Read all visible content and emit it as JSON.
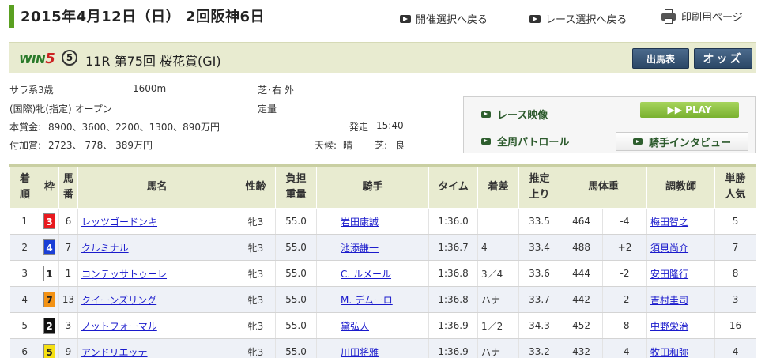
{
  "header": {
    "title": "2015年4月12日（日） 2回阪神6日",
    "links": [
      {
        "label": "開催選択へ戻る"
      },
      {
        "label": "レース選択へ戻る"
      },
      {
        "label": "印刷用ページ"
      }
    ]
  },
  "race": {
    "logo_win": "WIN",
    "logo_five": "5",
    "win5_leg": "5",
    "name": "11R 第75回 桜花賞(GI)",
    "buttons": {
      "entries": "出馬表",
      "odds": "オッズ"
    }
  },
  "info": {
    "class": "サラ系3歳",
    "distance": "1600m",
    "course": "芝･右 外",
    "conditions": "(国際)牝(指定) オープン",
    "weight_rule": "定量",
    "prize_label": "本賞金:",
    "prize": "8900、3600、2200、1300、890万円",
    "start_label": "発走",
    "start_time": "15:40",
    "addprize_label": "付加賞:",
    "addprize": "2723、 778、 389万円",
    "weather_label": "天候:",
    "weather": "晴",
    "going_label": "芝:",
    "going": "良"
  },
  "video": {
    "race_video": "レース映像",
    "play": "PLAY",
    "patrol": "全周パトロール",
    "interview": "騎手インタビュー"
  },
  "table": {
    "headers": {
      "rank_a": "着",
      "rank_b": "順",
      "frame": "枠",
      "num_a": "馬",
      "num_b": "番",
      "horse": "馬名",
      "sexage": "性齢",
      "weight_a": "負担",
      "weight_b": "重量",
      "jockey": "騎手",
      "time": "タイム",
      "margin": "着差",
      "last3f_a": "推定",
      "last3f_b": "上り",
      "bodyweight": "馬体重",
      "trainer": "調教師",
      "pop_a": "単勝",
      "pop_b": "人気"
    },
    "rows": [
      {
        "rank": "1",
        "frame": "3",
        "frame_bg": "#e8191e",
        "frame_fg": "#ffffff",
        "num": "6",
        "horse": "レッツゴードンキ",
        "sexage": "牝3",
        "weight": "55.0",
        "jockey": "岩田康誠",
        "time": "1:36.0",
        "margin": "",
        "last3f": "33.5",
        "bw": "464",
        "bw_diff": "-4",
        "trainer": "梅田智之",
        "pop": "5"
      },
      {
        "rank": "2",
        "frame": "4",
        "frame_bg": "#1a3fd6",
        "frame_fg": "#ffffff",
        "num": "7",
        "horse": "クルミナル",
        "sexage": "牝3",
        "weight": "55.0",
        "jockey": "池添謙一",
        "time": "1:36.7",
        "margin": "4",
        "last3f": "33.4",
        "bw": "488",
        "bw_diff": "+2",
        "trainer": "須貝尚介",
        "pop": "7"
      },
      {
        "rank": "3",
        "frame": "1",
        "frame_bg": "#ffffff",
        "frame_fg": "#222222",
        "num": "1",
        "horse": "コンテッサトゥーレ",
        "sexage": "牝3",
        "weight": "55.0",
        "jockey": "C. ルメール",
        "time": "1:36.8",
        "margin": "3／4",
        "last3f": "33.6",
        "bw": "444",
        "bw_diff": "-2",
        "trainer": "安田隆行",
        "pop": "8"
      },
      {
        "rank": "4",
        "frame": "7",
        "frame_bg": "#f39214",
        "frame_fg": "#222222",
        "num": "13",
        "horse": "クイーンズリング",
        "sexage": "牝3",
        "weight": "55.0",
        "jockey": "M. デムーロ",
        "time": "1:36.8",
        "margin": "ハナ",
        "last3f": "33.7",
        "bw": "442",
        "bw_diff": "-2",
        "trainer": "吉村圭司",
        "pop": "3"
      },
      {
        "rank": "5",
        "frame": "2",
        "frame_bg": "#111111",
        "frame_fg": "#ffffff",
        "num": "3",
        "horse": "ノットフォーマル",
        "sexage": "牝3",
        "weight": "55.0",
        "jockey": "黛弘人",
        "time": "1:36.9",
        "margin": "1／2",
        "last3f": "34.3",
        "bw": "452",
        "bw_diff": "-8",
        "trainer": "中野栄治",
        "pop": "16"
      },
      {
        "rank": "6",
        "frame": "5",
        "frame_bg": "#f5e012",
        "frame_fg": "#222222",
        "num": "9",
        "horse": "アンドリエッテ",
        "sexage": "牝3",
        "weight": "55.0",
        "jockey": "川田将雅",
        "time": "1:36.9",
        "margin": "ハナ",
        "last3f": "33.2",
        "bw": "432",
        "bw_diff": "-4",
        "trainer": "牧田和弥",
        "pop": "4"
      }
    ]
  },
  "colors": {
    "accent_green": "#5aa021",
    "banner_bg": "#e8ebd0",
    "button_dark": "#2b4766",
    "link_blue": "#1a1acc",
    "alt_row": "#eef1f7"
  }
}
